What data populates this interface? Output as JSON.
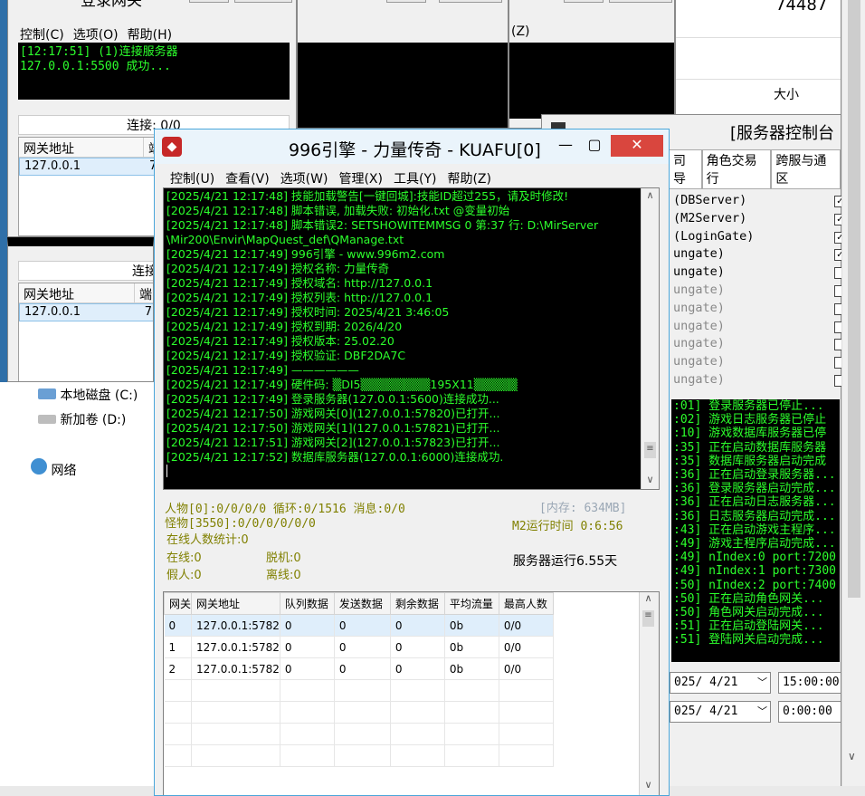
{
  "login_gate": {
    "title": "登录网关",
    "menu": [
      "控制(C)",
      "选项(O)",
      "帮助(H)"
    ],
    "log": [
      "[12:17:51] (1)连接服务器",
      "127.0.0.1:5500 成功..."
    ],
    "status": "连接: 0/0",
    "columns": [
      "网关地址",
      "端"
    ],
    "row": {
      "address": "127.0.0.1",
      "port": "7"
    }
  },
  "gate2": {
    "status": "连接",
    "columns": [
      "网关地址",
      "端"
    ],
    "row": {
      "address": "127.0.0.1",
      "port": "7"
    }
  },
  "bg_window": {
    "menu_fragment": "(Z)"
  },
  "top_right": {
    "number": "74487",
    "size_label": "大小"
  },
  "explorer": {
    "local_disk": "本地磁盘 (C:)",
    "new_volume": "新加卷 (D:)",
    "network": "网络"
  },
  "server_control": {
    "title": "[服务器控制台",
    "tabs": [
      "司导",
      "角色交易行",
      "跨服与通区"
    ],
    "services": [
      {
        "label": "(DBServer)",
        "checked": true,
        "dim": false
      },
      {
        "label": "(M2Server)",
        "checked": true,
        "dim": false
      },
      {
        "label": "(LoginGate)",
        "checked": true,
        "dim": false
      },
      {
        "label": "ungate)",
        "checked": true,
        "dim": false
      },
      {
        "label": "ungate)",
        "checked": false,
        "dim": false
      },
      {
        "label": "ungate)",
        "checked": false,
        "dim": true
      },
      {
        "label": "ungate)",
        "checked": false,
        "dim": true
      },
      {
        "label": "ungate)",
        "checked": false,
        "dim": true
      },
      {
        "label": "ungate)",
        "checked": false,
        "dim": true
      },
      {
        "label": "ungate)",
        "checked": false,
        "dim": true
      },
      {
        "label": "ungate)",
        "checked": false,
        "dim": true
      }
    ],
    "log": [
      ":01] 登录服务器已停止...",
      ":02] 游戏日志服务器已停止",
      ":10] 游戏数据库服务器已停",
      ":35] 正在启动数据库服务器",
      ":35] 数据库服务器启动完成",
      ":36] 正在启动登录服务器...",
      ":36] 登录服务器启动完成...",
      ":36] 正在启动日志服务器...",
      ":36] 日志服务器启动完成...",
      ":43] 正在启动游戏主程序...",
      ":49] 游戏主程序启动完成...",
      ":49] nIndex:0 port:7200",
      ":49] nIndex:1 port:7300",
      ":50] nIndex:2 port:7400",
      ":50] 正在启动角色网关...",
      ":50] 角色网关启动完成...",
      ":51] 正在启动登陆网关...",
      ":51] 登陆网关启动完成..."
    ],
    "date1": "025/ 4/21",
    "time1": "15:00:00",
    "date2": "025/ 4/21",
    "time2": "0:00:00"
  },
  "main": {
    "title": "996引擎 - 力量传奇 - KUAFU[0]",
    "menu": [
      "控制(U)",
      "查看(V)",
      "选项(W)",
      "管理(X)",
      "工具(Y)",
      "帮助(Z)"
    ],
    "log": [
      "[2025/4/21 12:17:48] 技能加载警告[一键回城]:技能ID超过255，请及时修改!",
      "[2025/4/21 12:17:48] 脚本错误, 加载失败: 初始化.txt  @变量初始",
      "[2025/4/21 12:17:48] 脚本错误2: SETSHOWITEMMSG 0 第:37 行: D:\\MirServer",
      "\\Mir200\\Envir\\MapQuest_def\\QManage.txt",
      "[2025/4/21 12:17:49] 996引擎 - www.996m2.com",
      "[2025/4/21 12:17:49] 授权名称: 力量传奇",
      "[2025/4/21 12:17:49] 授权域名: http://127.0.0.1",
      "[2025/4/21 12:17:49] 授权列表: http://127.0.0.1",
      "[2025/4/21 12:17:49] 授权时间: 2025/4/21 3:46:05",
      "[2025/4/21 12:17:49] 授权到期: 2026/4/20",
      "[2025/4/21 12:17:49] 授权版本: 25.02.20",
      "[2025/4/21 12:17:49] 授权验证: DBF2DA7C",
      "[2025/4/21 12:17:49] ——————",
      "[2025/4/21 12:17:49] 硬件码: ▒DI5▒▒▒▒▒▒▒▒195X11▒▒▒▒▒",
      "[2025/4/21 12:17:49] 登录服务器(127.0.0.1:5600)连接成功...",
      "[2025/4/21 12:17:50] 游戏网关[0](127.0.0.1:57820)已打开...",
      "[2025/4/21 12:17:50] 游戏网关[1](127.0.0.1:57821)已打开...",
      "[2025/4/21 12:17:51] 游戏网关[2](127.0.0.1:57823)已打开...",
      "[2025/4/21 12:17:52] 数据库服务器(127.0.0.1:6000)连接成功."
    ],
    "stats": {
      "line1": "人物[0]:0/0/0/0  循环:0/1516  消息:0/0",
      "line2": "怪物[3550]:0/0/0/0/0/0",
      "online_stat": "在线人数统计:0",
      "online": "在线:0",
      "offline_hang": "脱机:0",
      "fake": "假人:0",
      "disconnect": "离线:0",
      "memory": "[内存: 634MB]",
      "m2_runtime": "M2运行时间 0:6:56",
      "server_runtime": "服务器运行6.55天"
    },
    "grid": {
      "columns": [
        "网关",
        "网关地址",
        "队列数据",
        "发送数据",
        "剩余数据",
        "平均流量",
        "最高人数"
      ],
      "rows": [
        [
          "0",
          "127.0.0.1:5782",
          "0",
          "0",
          "0",
          "0b",
          "0/0"
        ],
        [
          "1",
          "127.0.0.1:5782",
          "0",
          "0",
          "0",
          "0b",
          "0/0"
        ],
        [
          "2",
          "127.0.0.1:5782",
          "0",
          "0",
          "0",
          "0b",
          "0/0"
        ]
      ]
    }
  }
}
